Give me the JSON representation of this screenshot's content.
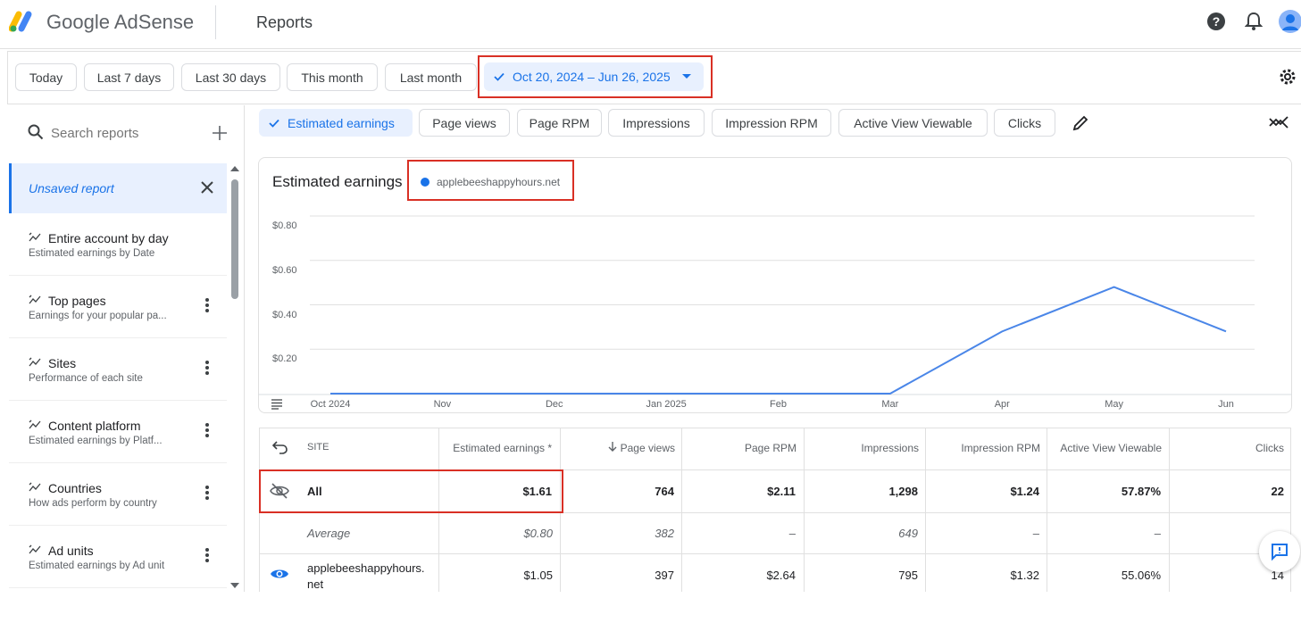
{
  "header": {
    "brand_google": "Google",
    "brand_product": "AdSense",
    "page_title": "Reports",
    "icons": [
      "help-icon",
      "notifications-icon",
      "account-avatar"
    ]
  },
  "date_filters": {
    "chips": [
      "Today",
      "Last 7 days",
      "Last 30 days",
      "This month",
      "Last month"
    ],
    "selected_range": "Oct 20, 2024 – Jun 26, 2025"
  },
  "sidebar": {
    "search_placeholder": "Search reports",
    "unsaved_report": "Unsaved report",
    "items": [
      {
        "title": "Entire account by day",
        "subtitle": "Estimated earnings by Date"
      },
      {
        "title": "Top pages",
        "subtitle": "Earnings for your popular pa..."
      },
      {
        "title": "Sites",
        "subtitle": "Performance of each site"
      },
      {
        "title": "Content platform",
        "subtitle": "Estimated earnings by Platf..."
      },
      {
        "title": "Countries",
        "subtitle": "How ads perform by country"
      },
      {
        "title": "Ad units",
        "subtitle": "Estimated earnings by Ad unit"
      }
    ]
  },
  "metrics": {
    "chips": [
      "Estimated earnings",
      "Page views",
      "Page RPM",
      "Impressions",
      "Impression RPM",
      "Active View Viewable",
      "Clicks"
    ]
  },
  "chart": {
    "title": "Estimated earnings",
    "legend": "applebeeshappyhours.net"
  },
  "chart_data": {
    "type": "line",
    "title": "Estimated earnings",
    "x": [
      "Oct 2024",
      "Nov",
      "Dec",
      "Jan 2025",
      "Feb",
      "Mar",
      "Apr",
      "May",
      "Jun"
    ],
    "series": [
      {
        "name": "applebeeshappyhours.net",
        "values": [
          0,
          0,
          0,
          0,
          0,
          0,
          0.28,
          0.48,
          0.28
        ]
      }
    ],
    "y_ticks": [
      "$0.20",
      "$0.40",
      "$0.60",
      "$0.80"
    ],
    "ylim": [
      0,
      0.8
    ],
    "grid": true,
    "color": "#4a86e8"
  },
  "table": {
    "headers": [
      "SITE",
      "Estimated earnings *",
      "Page views",
      "Page RPM",
      "Impressions",
      "Impression RPM",
      "Active View Viewable",
      "Clicks"
    ],
    "rows": [
      {
        "site": "All",
        "earnings": "$1.61",
        "views": "764",
        "rpm": "$2.11",
        "impr": "1,298",
        "irpm": "$1.24",
        "viewable": "57.87%",
        "clicks": "22"
      },
      {
        "site": "Average",
        "earnings": "$0.80",
        "views": "382",
        "rpm": "–",
        "impr": "649",
        "irpm": "–",
        "viewable": "–",
        "clicks": ""
      },
      {
        "site_line1": "applebeeshappyhours.",
        "site_line2": "net",
        "earnings": "$1.05",
        "views": "397",
        "rpm": "$2.64",
        "impr": "795",
        "irpm": "$1.32",
        "viewable": "55.06%",
        "clicks": "14"
      }
    ]
  }
}
